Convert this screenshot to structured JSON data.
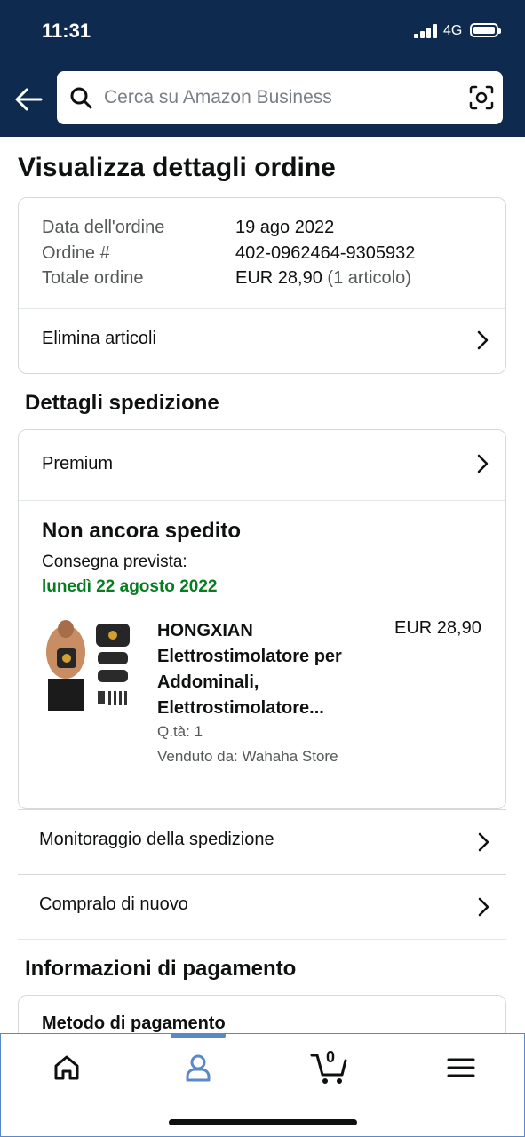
{
  "status_bar": {
    "time": "11:31",
    "network": "4G"
  },
  "search": {
    "placeholder": "Cerca su Amazon Business"
  },
  "page_title": "Visualizza dettagli ordine",
  "order_summary": {
    "date_label": "Data dell'ordine",
    "date_value": "19 ago 2022",
    "number_label": "Ordine #",
    "number_value": "402-0962464-9305932",
    "total_label": "Totale ordine",
    "total_value": "EUR 28,90",
    "total_items": "(1 articolo)",
    "delete_items_label": "Elimina articoli"
  },
  "shipping": {
    "section_title": "Dettagli spedizione",
    "method": "Premium",
    "status": "Non ancora spedito",
    "delivery_label": "Consegna prevista:",
    "delivery_date": "lunedì 22 agosto 2022",
    "product": {
      "name_line1": "HONGXIAN",
      "name_line2": "Elettrostimolatore per",
      "name_line3": "Addominali,",
      "name_line4": "Elettrostimolatore...",
      "price": "EUR 28,90",
      "quantity": "Q.tà: 1",
      "seller": "Venduto da: Wahaha Store"
    },
    "track_label": "Monitoraggio della spedizione",
    "buy_again_label": "Compralo di nuovo"
  },
  "payment": {
    "section_title": "Informazioni di pagamento",
    "method_label": "Metodo di pagamento"
  },
  "tabbar": {
    "cart_count": "0",
    "active_tab": "account"
  },
  "colors": {
    "header_bg": "#0f2a4f",
    "delivery_green": "#067d20",
    "tab_active": "#5b89c7"
  }
}
